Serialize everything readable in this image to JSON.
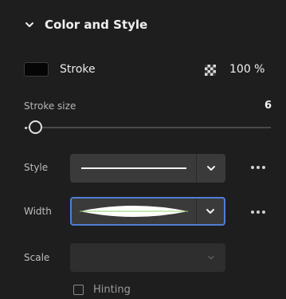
{
  "section": {
    "title": "Color and Style",
    "icon": "chevron-down-icon"
  },
  "stroke": {
    "label": "Stroke",
    "swatch_color": "#050505",
    "opacity_icon": "checkerboard-icon",
    "opacity": "100 %"
  },
  "stroke_size": {
    "label": "Stroke size",
    "value": "6",
    "slider_fraction": 0.02
  },
  "style": {
    "label": "Style",
    "preview": "solid-line"
  },
  "width": {
    "label": "Width",
    "preview": "tapered-ends-profile",
    "focused": true
  },
  "scale": {
    "label": "Scale",
    "enabled": false
  },
  "hinting": {
    "label": "Hinting",
    "checked": false
  },
  "colors": {
    "background": "#1e1e1e",
    "control": "#3a3a3a",
    "focus_ring": "#4e7fd6"
  }
}
